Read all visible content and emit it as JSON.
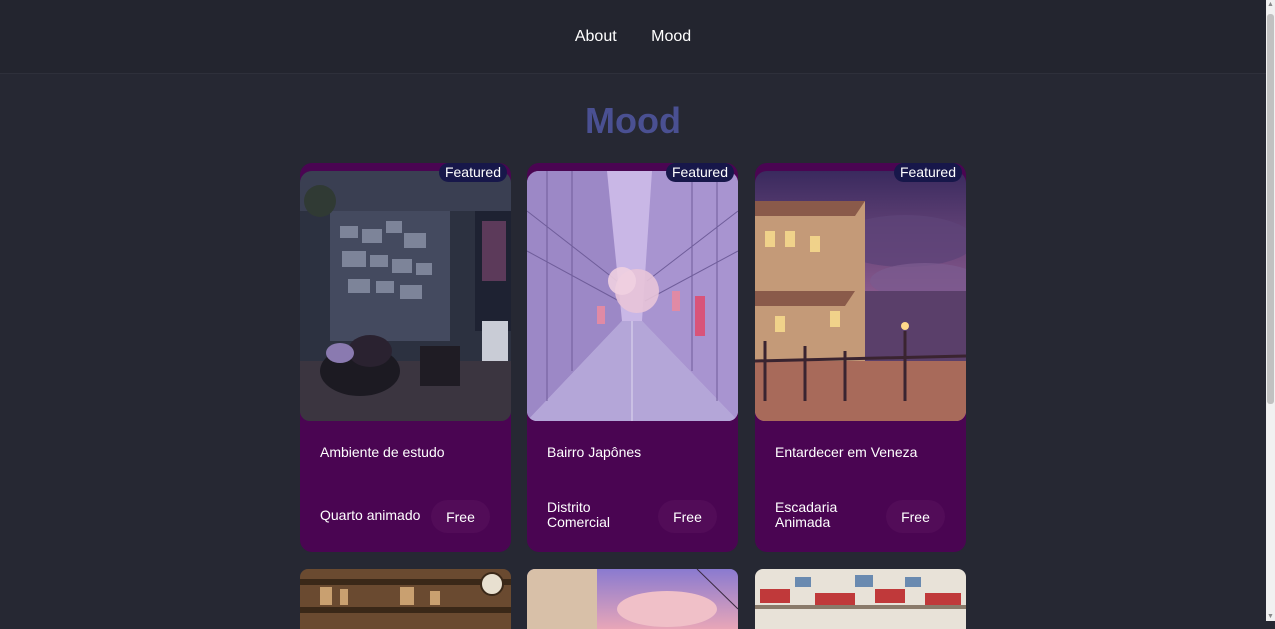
{
  "nav": {
    "links": [
      {
        "label": "About"
      },
      {
        "label": "Mood"
      }
    ]
  },
  "page": {
    "title": "Mood"
  },
  "cards": [
    {
      "badge": "Featured",
      "title": "Ambiente de estudo",
      "subtitle": "Quarto animado",
      "price": "Free"
    },
    {
      "badge": "Featured",
      "title": "Bairro Japônes",
      "subtitle": "Distrito Comercial",
      "price": "Free"
    },
    {
      "badge": "Featured",
      "title": "Entardecer em Veneza",
      "subtitle": "Escadaria Animada",
      "price": "Free"
    }
  ],
  "colors": {
    "background": "#262833",
    "header": "#23252f",
    "title": "#4a5092",
    "card": "#4a0552",
    "badge": "#17174a"
  }
}
